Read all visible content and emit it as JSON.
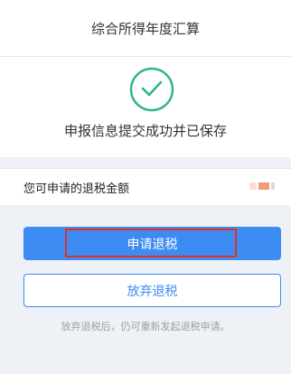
{
  "header": {
    "title": "综合所得年度汇算"
  },
  "success": {
    "icon": "check-circle-icon",
    "message": "申报信息提交成功并已保存",
    "color": "#2fb67f"
  },
  "refund": {
    "label": "您可申请的退税金额",
    "amount_masked": true
  },
  "actions": {
    "apply_label": "申请退税",
    "giveup_label": "放弃退税",
    "hint": "放弃退税后，仍可重新发起退税申请。",
    "accent_color": "#3d8cf3",
    "highlight_color": "#e0302b"
  }
}
